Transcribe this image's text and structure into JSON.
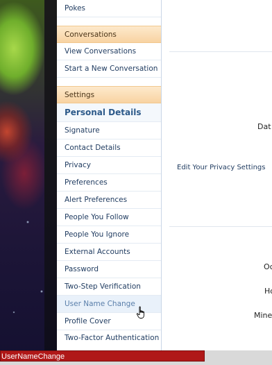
{
  "nav": {
    "pokes": "Pokes",
    "conversations_header": "Conversations",
    "conversations_items": [
      {
        "label": "View Conversations"
      },
      {
        "label": "Start a New Conversation"
      }
    ],
    "settings_header": "Settings",
    "personal_details_title": "Personal Details",
    "settings_items": [
      {
        "label": "Signature"
      },
      {
        "label": "Contact Details"
      },
      {
        "label": "Privacy"
      },
      {
        "label": "Preferences"
      },
      {
        "label": "Alert Preferences"
      },
      {
        "label": "People You Follow"
      },
      {
        "label": "People You Ignore"
      },
      {
        "label": "External Accounts"
      },
      {
        "label": "Password"
      },
      {
        "label": "Two-Step Verification"
      },
      {
        "label": "User Name Change"
      },
      {
        "label": "Profile Cover"
      },
      {
        "label": "Two-Factor Authentication"
      }
    ]
  },
  "main": {
    "dat_fragment": "Dat",
    "privacy_link": "Edit Your Privacy Settings",
    "oc_fragment": "Oc",
    "ho_fragment": "Ho",
    "mine_fragment": "Mine"
  },
  "status": {
    "url_fragment": "UserNameChange"
  },
  "icons": {
    "cursor": "hand-pointer-icon"
  },
  "colors": {
    "section_header_bg": "#f8d3a2",
    "link_text": "#1e3a5f",
    "status_tooltip_bg": "#b01818"
  }
}
